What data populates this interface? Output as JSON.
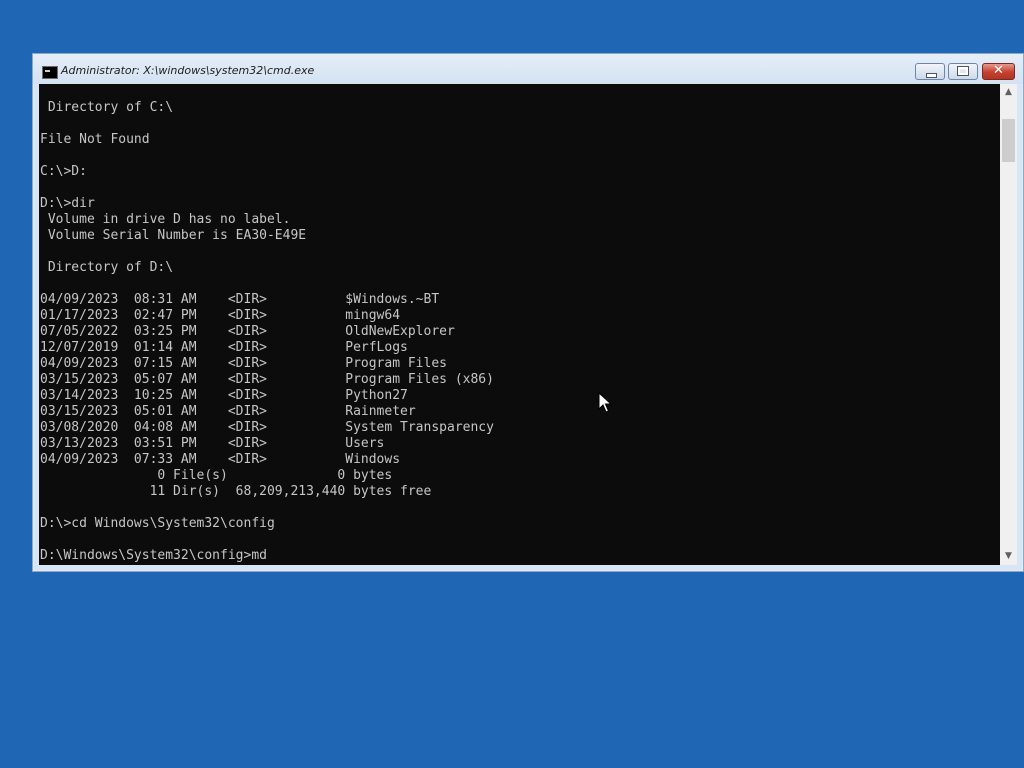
{
  "desktop": {
    "background": "#1f66b4"
  },
  "window": {
    "title": "Administrator: X:\\windows\\system32\\cmd.exe",
    "buttons": {
      "minimize": "minimize-icon",
      "maximize": "maximize-icon",
      "close": "close-icon"
    }
  },
  "console": {
    "colors": {
      "background": "#0c0c0c",
      "text": "#c6c6c6"
    },
    "lines": [
      " Directory of C:\\",
      "",
      "File Not Found",
      "",
      "C:\\>D:",
      "",
      "D:\\>dir",
      " Volume in drive D has no label.",
      " Volume Serial Number is EA30-E49E",
      "",
      " Directory of D:\\",
      "",
      "04/09/2023  08:31 AM    <DIR>          $Windows.~BT",
      "01/17/2023  02:47 PM    <DIR>          mingw64",
      "07/05/2022  03:25 PM    <DIR>          OldNewExplorer",
      "12/07/2019  01:14 AM    <DIR>          PerfLogs",
      "04/09/2023  07:15 AM    <DIR>          Program Files",
      "03/15/2023  05:07 AM    <DIR>          Program Files (x86)",
      "03/14/2023  10:25 AM    <DIR>          Python27",
      "03/15/2023  05:01 AM    <DIR>          Rainmeter",
      "03/08/2020  04:08 AM    <DIR>          System Transparency",
      "03/13/2023  03:51 PM    <DIR>          Users",
      "04/09/2023  07:33 AM    <DIR>          Windows",
      "               0 File(s)              0 bytes",
      "              11 Dir(s)  68,209,213,440 bytes free",
      "",
      "D:\\>cd Windows\\System32\\config",
      "",
      "D:\\Windows\\System32\\config>md"
    ]
  }
}
